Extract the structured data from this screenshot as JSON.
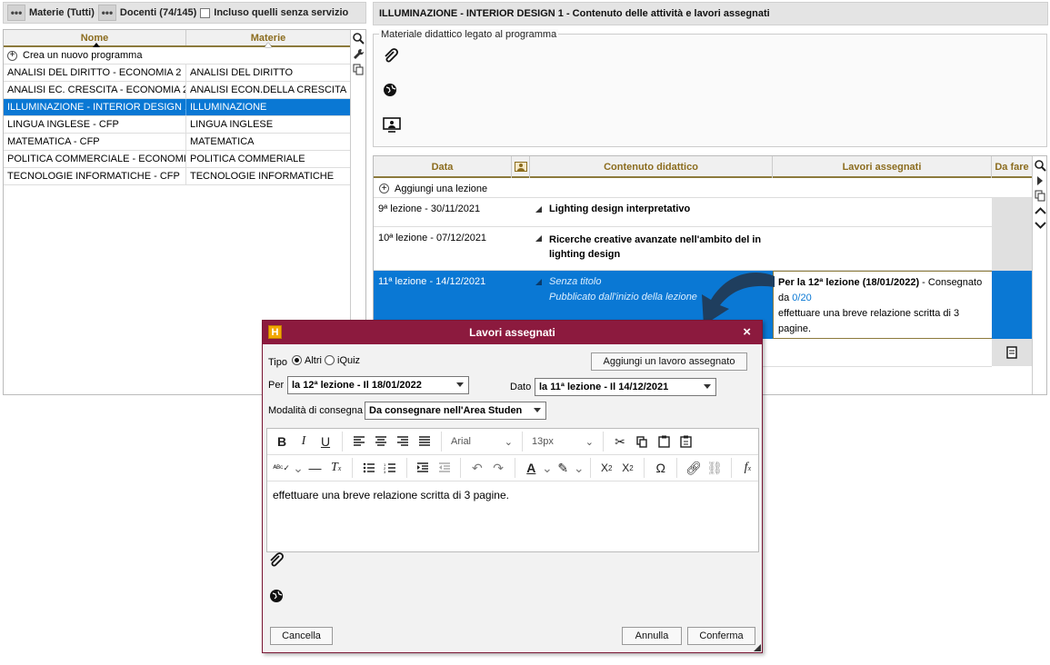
{
  "left_toolbar": {
    "materie_label": "Materie (Tutti)",
    "docenti_label": "Docenti (74/145)",
    "incluso_label": "Incluso quelli senza servizio"
  },
  "left_table": {
    "headers": [
      "Nome",
      "Materie"
    ],
    "create_label": "Crea un nuovo programma",
    "rows": [
      {
        "nome": "ANALISI DEL DIRITTO - ECONOMIA 2",
        "materia": "ANALISI DEL DIRITTO"
      },
      {
        "nome": "ANALISI EC. CRESCITA - ECONOMIA 2",
        "materia": "ANALISI ECON.DELLA CRESCITA"
      },
      {
        "nome": "ILLUMINAZIONE - INTERIOR DESIGN 1",
        "materia": "ILLUMINAZIONE"
      },
      {
        "nome": "LINGUA INGLESE - CFP",
        "materia": "LINGUA INGLESE"
      },
      {
        "nome": "MATEMATICA - CFP",
        "materia": "MATEMATICA"
      },
      {
        "nome": "POLITICA COMMERCIALE - ECONOMIA 2",
        "materia": "POLITICA COMMERIALE"
      },
      {
        "nome": "TECNOLOGIE INFORMATICHE - CFP",
        "materia": "TECNOLOGIE INFORMATICHE"
      }
    ]
  },
  "right_header": {
    "title": "ILLUMINAZIONE - INTERIOR DESIGN 1 - Contenuto delle attività e lavori assegnati"
  },
  "material": {
    "legend": "Materiale didattico legato al programma"
  },
  "lessons": {
    "headers": {
      "data": "Data",
      "contenuto": "Contenuto didattico",
      "lavori": "Lavori assegnati",
      "dafare": "Da fare"
    },
    "add_label": "Aggiungi una lezione",
    "rows": [
      {
        "date": "9ª lezione - 30/11/2021",
        "title": "Lighting design interpretativo"
      },
      {
        "date": "10ª lezione - 07/12/2021",
        "title": "Ricerche creative avanzate nell'ambito del in lighting design"
      },
      {
        "date": "11ª lezione - 14/12/2021",
        "title": "Senza titolo",
        "subtitle": "Pubblicato dall'inizio della lezione"
      }
    ],
    "assigned": {
      "bold": "Per la 12ª lezione (18/01/2022)",
      "text1": " - Consegnato da ",
      "count": "0/20",
      "desc": "effettuare una breve relazione scritta di 3 pagine."
    }
  },
  "dialog": {
    "logo": "H",
    "title": "Lavori assegnati",
    "tipo_label": "Tipo",
    "altri_label": "Altri",
    "iquiz_label": "iQuiz",
    "add_button": "Aggiungi un lavoro assegnato",
    "per_label": "Per",
    "per_value": "la 12ª lezione - Il 18/01/2022",
    "dato_label": "Dato",
    "dato_value": "la 11ª lezione - Il 14/12/2021",
    "modalita_label": "Modalità di consegna",
    "modalita_value": "Da consegnare nell'Area Studen",
    "font_family": "Arial",
    "font_size": "13px",
    "editor_text": "effettuare una breve relazione scritta di 3 pagine.",
    "cancella": "Cancella",
    "annulla": "Annulla",
    "conferma": "Conferma"
  },
  "colors": {
    "accent": "#0a78d4",
    "dialog_title": "#8c1a3e",
    "header_text": "#8c6d1f"
  }
}
